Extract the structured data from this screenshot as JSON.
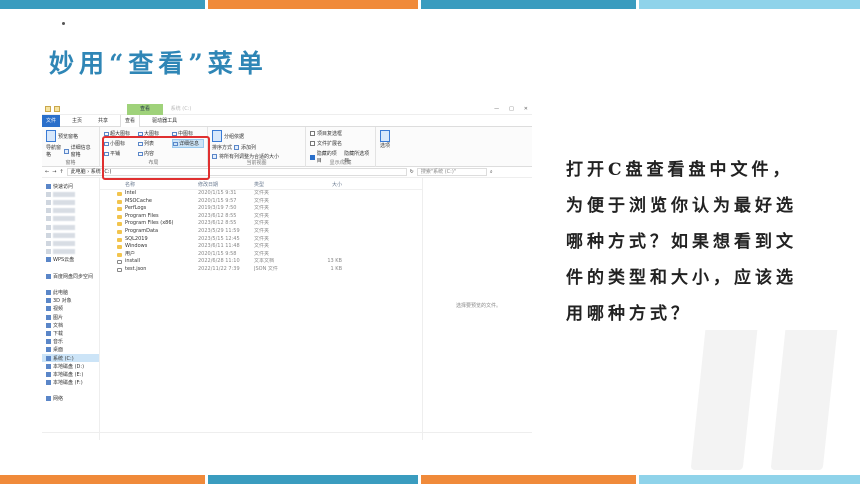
{
  "slide": {
    "title": "妙用“查看”菜单",
    "explanation": "打开C盘查看盘中文件，为便于浏览你认为最好选哪种方式？如果想看到文件的类型和大小，应该选用哪种方式？",
    "colors": {
      "accent_blue": "#3a9cbf",
      "accent_orange": "#f08a3a",
      "title_blue": "#2f86b6",
      "highlight_red": "#e03030"
    }
  },
  "explorer": {
    "context_tab": "查看",
    "context_tab2": "系统 (C:)",
    "menu_tabs": [
      "文件",
      "主页",
      "共享",
      "查看",
      "驱动器工具"
    ],
    "ribbon": {
      "pane": {
        "nav_pane": "导航窗格",
        "preview_pane": "预览窗格",
        "details_pane": "详细信息窗格",
        "label": "窗格"
      },
      "layout": {
        "items": [
          "超大图标",
          "大图标",
          "中图标",
          "小图标",
          "列表",
          "详细信息",
          "平铺",
          "内容"
        ],
        "selected": "详细信息",
        "label": "布局"
      },
      "current_view": {
        "sort": "排序方式",
        "group": "分组依据",
        "add_column": "添加列",
        "fit_columns": "将所有列调整为合适的大小",
        "label": "当前视图"
      },
      "show_hide": {
        "item_checkbox": "项目复选框",
        "file_ext": "文件扩展名",
        "hidden_items": "隐藏的项目",
        "hide_selected": "隐藏所选项目",
        "options": "选项",
        "label": "显示/隐藏"
      }
    },
    "address": {
      "path": "此电脑 › 系统 (C:)",
      "search_placeholder": "搜索\"系统 (C:)\""
    },
    "nav_items": [
      {
        "label": "快速访问",
        "blur": false
      },
      {
        "label": "",
        "blur": true
      },
      {
        "label": "",
        "blur": true
      },
      {
        "label": "",
        "blur": true
      },
      {
        "label": "",
        "blur": true
      },
      {
        "label": "",
        "blur": true
      },
      {
        "label": "",
        "blur": true
      },
      {
        "label": "",
        "blur": true
      },
      {
        "label": "",
        "blur": true
      },
      {
        "label": "WPS云盘",
        "blur": false
      },
      {
        "label": "",
        "blur": false
      },
      {
        "label": "百度网盘同步空间",
        "blur": false
      },
      {
        "label": "",
        "blur": false
      },
      {
        "label": "此电脑",
        "blur": false
      },
      {
        "label": "3D 对象",
        "blur": false
      },
      {
        "label": "视频",
        "blur": false
      },
      {
        "label": "图片",
        "blur": false
      },
      {
        "label": "文档",
        "blur": false
      },
      {
        "label": "下载",
        "blur": false
      },
      {
        "label": "音乐",
        "blur": false
      },
      {
        "label": "桌面",
        "blur": false
      },
      {
        "label": "系统 (C:)",
        "blur": false
      },
      {
        "label": "本地磁盘 (D:)",
        "blur": false
      },
      {
        "label": "本地磁盘 (E:)",
        "blur": false
      },
      {
        "label": "本地磁盘 (F:)",
        "blur": false
      },
      {
        "label": "",
        "blur": false
      },
      {
        "label": "网络",
        "blur": false
      }
    ],
    "columns": [
      "名称",
      "修改日期",
      "类型",
      "大小"
    ],
    "files": [
      {
        "name": "Intel",
        "date": "2020/1/15 9:31",
        "type": "文件夹",
        "size": "",
        "folder": true
      },
      {
        "name": "MSOCache",
        "date": "2020/1/15 9:57",
        "type": "文件夹",
        "size": "",
        "folder": true
      },
      {
        "name": "PerfLogs",
        "date": "2019/3/19 7:50",
        "type": "文件夹",
        "size": "",
        "folder": true
      },
      {
        "name": "Program Files",
        "date": "2023/6/12 8:55",
        "type": "文件夹",
        "size": "",
        "folder": true
      },
      {
        "name": "Program Files (x86)",
        "date": "2023/6/12 8:55",
        "type": "文件夹",
        "size": "",
        "folder": true
      },
      {
        "name": "ProgramData",
        "date": "2023/5/29 11:59",
        "type": "文件夹",
        "size": "",
        "folder": true
      },
      {
        "name": "SQL2019",
        "date": "2023/5/15 12:45",
        "type": "文件夹",
        "size": "",
        "folder": true
      },
      {
        "name": "Windows",
        "date": "2023/6/11 11:48",
        "type": "文件夹",
        "size": "",
        "folder": true
      },
      {
        "name": "用户",
        "date": "2020/1/15 9:58",
        "type": "文件夹",
        "size": "",
        "folder": true
      },
      {
        "name": "install",
        "date": "2022/6/28 11:10",
        "type": "文本文档",
        "size": "13 KB",
        "folder": false
      },
      {
        "name": "test.json",
        "date": "2022/11/22 7:39",
        "type": "JSON 文件",
        "size": "1 KB",
        "folder": false
      }
    ],
    "preview_message": "选择要预览的文件。"
  }
}
